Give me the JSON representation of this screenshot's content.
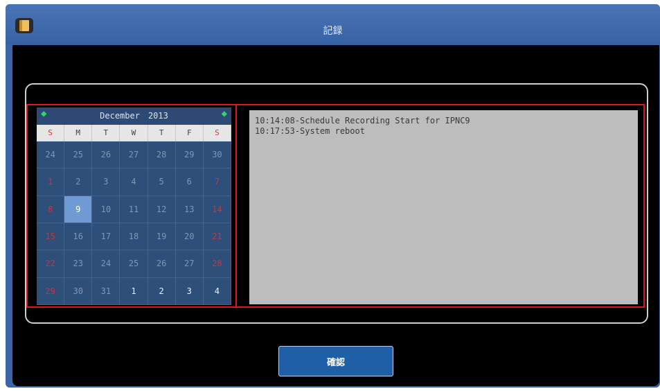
{
  "window": {
    "title": "記録",
    "icon": "app-book-icon"
  },
  "calendar": {
    "month": "December",
    "year": "2013",
    "prev_icon": "arrow-left-icon",
    "next_icon": "arrow-right-icon",
    "weekdays": [
      "S",
      "M",
      "T",
      "W",
      "T",
      "F",
      "S"
    ],
    "selected_day": "9",
    "days": [
      [
        "24",
        "25",
        "26",
        "27",
        "28",
        "29",
        "30"
      ],
      [
        "1",
        "2",
        "3",
        "4",
        "5",
        "6",
        "7"
      ],
      [
        "8",
        "9",
        "10",
        "11",
        "12",
        "13",
        "14"
      ],
      [
        "15",
        "16",
        "17",
        "18",
        "19",
        "20",
        "21"
      ],
      [
        "22",
        "23",
        "24",
        "25",
        "26",
        "27",
        "28"
      ],
      [
        "29",
        "30",
        "31",
        "1",
        "2",
        "3",
        "4"
      ]
    ]
  },
  "log": {
    "lines": [
      "10:14:08-Schedule Recording Start for IPNC9",
      "10:17:53-System reboot"
    ]
  },
  "buttons": {
    "close_label": "確認"
  },
  "colors": {
    "title_bar": "#3a66a8",
    "highlight_outline": "#e0161e",
    "selected_day": "#6f9ad2",
    "weekend_text": "#c0393d"
  }
}
